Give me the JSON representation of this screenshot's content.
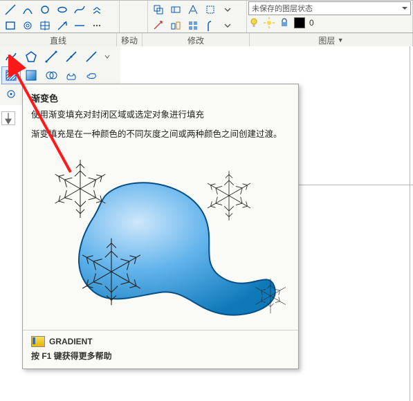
{
  "ribbon": {
    "group_line_label": "直线",
    "group_move_label": "移动",
    "mod_panel_label": "修改",
    "layer_panel_label": "图层",
    "layer_combo": "未保存的图层状态",
    "layer_value": "0"
  },
  "tooltip": {
    "title": "渐变色",
    "desc1": "使用渐变填充对封闭区域或选定对象进行填充",
    "desc2": "渐变填充是在一种颜色的不同灰度之间或两种颜色之间创建过渡。",
    "command": "GRADIENT",
    "hint": "按 F1 键获得更多帮助"
  },
  "icons": {
    "polyline": "polyline-icon",
    "polygon": "polygon-icon",
    "line-a": "line-a-icon",
    "line-b": "line-b-icon",
    "line-c": "line-c-icon",
    "line-d": "line-d-icon",
    "hatch": "hatch-icon",
    "gradient": "gradient-icon",
    "boundary": "boundary-icon",
    "region": "region-icon",
    "revcloud": "revcloud-icon",
    "sun": "sun-icon",
    "bulb": "bulb-icon",
    "lock": "lock-icon",
    "swatch": "color-swatch"
  }
}
